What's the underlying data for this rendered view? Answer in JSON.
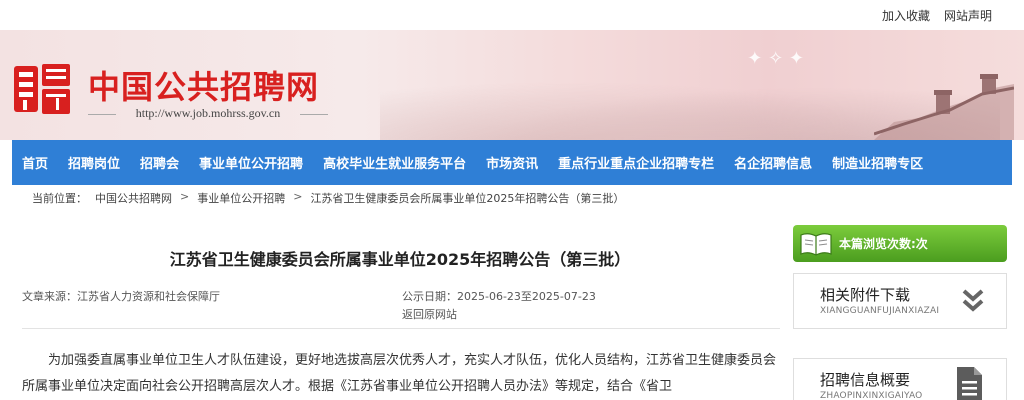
{
  "topbar": {
    "links": [
      "加入收藏",
      "网站声明"
    ]
  },
  "logo": {
    "title": "中国公共招聘网",
    "url": "http://www.job.mohrss.gov.cn"
  },
  "nav": {
    "items": [
      "首页",
      "招聘岗位",
      "招聘会",
      "事业单位公开招聘",
      "高校毕业生就业服务平台",
      "市场资讯",
      "重点行业重点企业招聘专栏",
      "名企招聘信息",
      "制造业招聘专区"
    ]
  },
  "breadcrumb": {
    "label": "当前位置：",
    "items": [
      "中国公共招聘网",
      "事业单位公开招聘",
      "江苏省卫生健康委员会所属事业单位2025年招聘公告（第三批）"
    ]
  },
  "article": {
    "title": "江苏省卫生健康委员会所属事业单位2025年招聘公告（第三批）",
    "source": "文章来源：江苏省人力资源和社会保障厅",
    "date": "公示日期：2025-06-23至2025-07-23",
    "back": "返回原网站",
    "body": "为加强委直属事业单位卫生人才队伍建设，更好地选拔高层次优秀人才，充实人才队伍，优化人员结构，江苏省卫生健康委员会所属事业单位决定面向社会公开招聘高层次人才。根据《江苏省事业单位公开招聘人员办法》等规定，结合《省卫"
  },
  "sidebar": {
    "views": "本篇浏览次数:次",
    "attachments": {
      "title": "相关附件下载",
      "pinyin": "XIANGGUANFUJIANXIAZAI"
    },
    "overview": {
      "title": "招聘信息概要",
      "pinyin": "ZHAOPINXINXIGAIYAO"
    }
  },
  "colors": {
    "nav": "#2f7fd6",
    "logo": "#d8201f",
    "green": "#5aaa28"
  }
}
